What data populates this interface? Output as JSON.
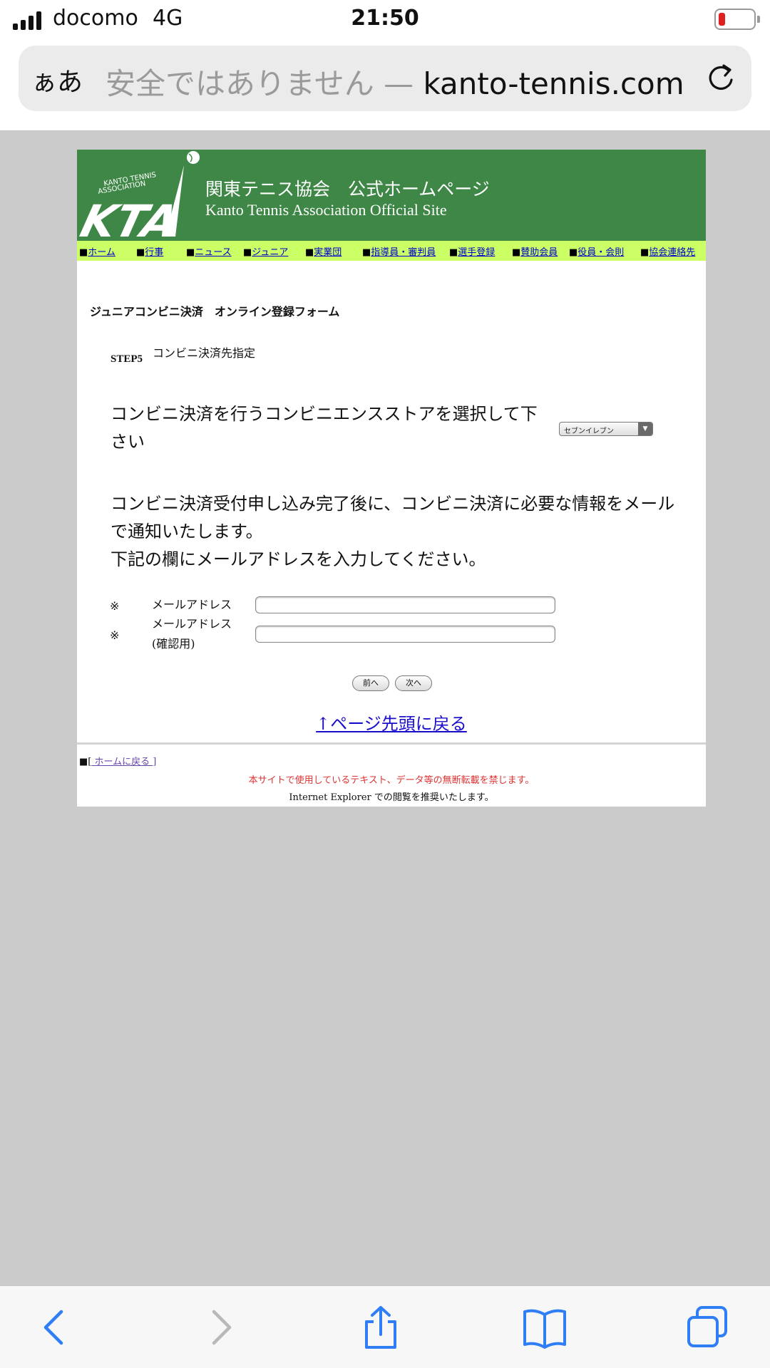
{
  "status_bar": {
    "carrier": "docomo",
    "network": "4G",
    "time": "21:50",
    "battery_level_fraction": 0.12
  },
  "address_bar": {
    "aa_label": "ぁあ",
    "insecure_label": "安全ではありません — ",
    "domain": "kanto-tennis.com"
  },
  "site_header": {
    "title_jp": "関東テニス協会　公式ホームページ",
    "title_en": "Kanto Tennis Association Official Site",
    "logo_text": "KTA",
    "logo_subtext": "KANTO TENNIS ASSOCIATION"
  },
  "nav": {
    "bullet": "■",
    "items": [
      {
        "label": "ホーム"
      },
      {
        "label": "行事"
      },
      {
        "label": "ニュース"
      },
      {
        "label": "ジュニア"
      },
      {
        "label": "実業団"
      },
      {
        "label": "指導員・審判員"
      },
      {
        "label": "選手登録"
      },
      {
        "label": "賛助会員"
      },
      {
        "label": "役員・会則"
      },
      {
        "label": "協会連絡先"
      }
    ]
  },
  "form": {
    "title": "ジュニアコンビニ決済　オンライン登録フォーム",
    "step_label": "STEP5",
    "step_name": "コンビニ決済先指定",
    "store_instruction": "コンビニ決済を行うコンビニエンスストアを選択して下さい",
    "store_select": {
      "value": "セブンイレブン",
      "arrow": "▼"
    },
    "mail_instruction_1": "コンビニ決済受付申し込み完了後に、コンビニ決済に必要な情報をメールで通知いたします。",
    "mail_instruction_2": "下記の欄にメールアドレスを入力してください。",
    "required_mark": "※",
    "fields": [
      {
        "label": "メールアドレス",
        "label_sub": "",
        "value": ""
      },
      {
        "label": "メールアドレス",
        "label_sub": "(確認用)",
        "value": ""
      }
    ],
    "prev_button": "前へ",
    "next_button": "次へ"
  },
  "page_links": {
    "back_to_top": "↑ページ先頭に戻る",
    "home_prefix": "■[",
    "home_link": " ホームに戻る ",
    "home_suffix": "]"
  },
  "footer": {
    "copyright": "本サイトで使用しているテキスト、データ等の無断転載を禁じます。",
    "ie_note": "Internet Explorer での閲覧を推奨いたします。"
  },
  "toolbar": {
    "icons": [
      "back-icon",
      "forward-icon",
      "share-icon",
      "bookmarks-icon",
      "tabs-icon"
    ]
  },
  "colors": {
    "header_green": "#3f8746",
    "nav_lime": "#ccff66",
    "link_blue": "#1a0dcc",
    "warning_red": "#dd3333",
    "safari_blue": "#2f7ef6",
    "battery_red": "#e02020"
  }
}
